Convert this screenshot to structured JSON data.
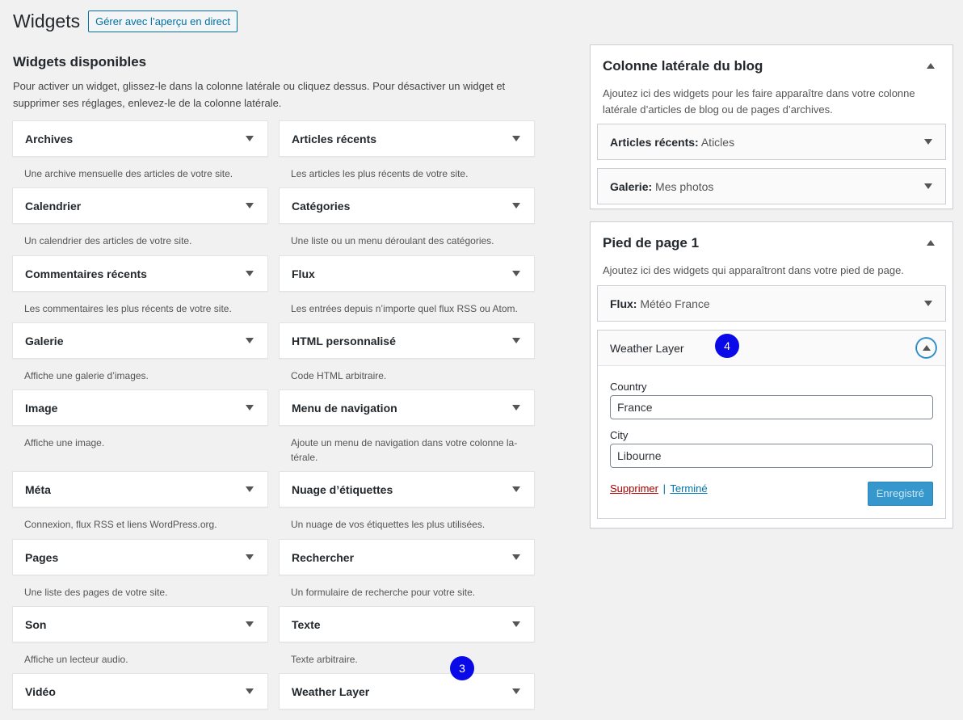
{
  "header": {
    "title": "Widgets",
    "live_preview_button": "Gérer avec l’aperçu en direct"
  },
  "available": {
    "title": "Widgets disponibles",
    "description": "Pour activer un widget, glissez-le dans la colonne latérale ou cliquez dessus. Pour désactiver un widget et supprimer ses réglages, enlevez-le de la colonne latérale.",
    "columns": [
      [
        {
          "label": "Archives",
          "desc": "Une archive mensuelle des articles de votre site."
        },
        {
          "label": "Calendrier",
          "desc": "Un calendrier des articles de votre site."
        },
        {
          "label": "Commentaires récents",
          "desc": "Les commentaires les plus récents de votre site."
        },
        {
          "label": "Galerie",
          "desc": "Affiche une galerie d’images."
        },
        {
          "label": "Image",
          "desc": "Affiche une image."
        },
        {
          "label": "Méta",
          "desc": "Connexion, flux RSS et liens WordPress.org."
        },
        {
          "label": "Pages",
          "desc": "Une liste des pages de votre site."
        },
        {
          "label": "Son",
          "desc": "Affiche un lecteur audio."
        },
        {
          "label": "Vidéo",
          "desc": ""
        }
      ],
      [
        {
          "label": "Articles récents",
          "desc": "Les articles les plus récents de votre site."
        },
        {
          "label": "Catégories",
          "desc": "Une liste ou un menu déroulant des catégories."
        },
        {
          "label": "Flux",
          "desc": "Les entrées depuis n’importe quel flux RSS ou Atom."
        },
        {
          "label": "HTML personnalisé",
          "desc": "Code HTML arbitraire."
        },
        {
          "label": "Menu de navigation",
          "desc": "Ajoute un menu de navigation dans votre colonne la-térale."
        },
        {
          "label": "Nuage d’étiquettes",
          "desc": "Un nuage de vos étiquettes les plus utilisées."
        },
        {
          "label": "Rechercher",
          "desc": "Un formulaire de recherche pour votre site."
        },
        {
          "label": "Texte",
          "desc": "Texte arbitraire."
        },
        {
          "label": "Weather Layer",
          "desc": ""
        }
      ]
    ]
  },
  "sidebar_blog": {
    "title": "Colonne latérale du blog",
    "description": "Ajoutez ici des widgets pour les faire apparaître dans votre colonne latérale d’articles de blog ou de pages d’archives.",
    "widgets": [
      {
        "name": "Articles récents:",
        "instance": "Aticles"
      },
      {
        "name": "Galerie:",
        "instance": "Mes photos"
      }
    ]
  },
  "footer1": {
    "title": "Pied de page 1",
    "description": "Ajoutez ici des widgets qui apparaîtront dans votre pied de page.",
    "flux_widget": {
      "name": "Flux:",
      "instance": "Météo France"
    },
    "weather_widget": {
      "title": "Weather Layer",
      "country_label": "Country",
      "country_value": "France",
      "city_label": "City",
      "city_value": "Libourne",
      "delete_link": "Supprimer",
      "separator": "|",
      "done_link": "Terminé",
      "save_button": "Enregistré"
    }
  },
  "annotations": {
    "badge3": "3",
    "badge4": "4"
  }
}
